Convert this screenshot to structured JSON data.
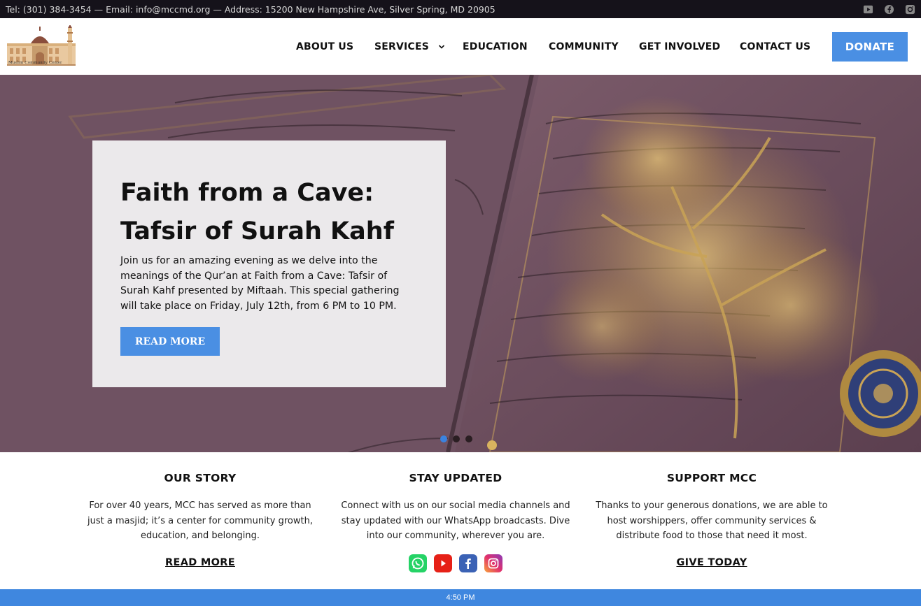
{
  "topbar": {
    "contact": "Tel: (301) 384-3454 — Email: info@mccmd.org — Address: 15200 New Hampshire Ave, Silver Spring, MD 20905",
    "socials": [
      "youtube-icon",
      "facebook-icon",
      "instagram-icon"
    ]
  },
  "header": {
    "logo_text": "Muslim Community Center",
    "nav": {
      "about": "ABOUT US",
      "services": "SERVICES",
      "education": "EDUCATION",
      "community": "COMMUNITY",
      "involved": "GET INVOLVED",
      "contact": "CONTACT US"
    },
    "donate": "DONATE"
  },
  "hero": {
    "title": "Faith from a Cave: Tafsir of Surah Kahf",
    "description": "Join us for an amazing evening as we delve into the meanings of the Qur’an at Faith from a Cave: Tafsir of Surah Kahf presented by Miftaah. This special gathering will take place on Friday, July 12th, from 6 PM to 10 PM.",
    "button": "READ MORE",
    "slides": 3,
    "active_slide": 1
  },
  "info": {
    "story": {
      "title": "OUR STORY",
      "text": "For over 40 years, MCC has served as more than just a masjid; it’s a center for community growth, education, and belonging.",
      "link": "READ MORE"
    },
    "updated": {
      "title": "STAY UPDATED",
      "text": "Connect with us on our social media channels and stay updated with our WhatsApp broadcasts. Dive into our community, wherever you are.",
      "icons": [
        "whatsapp-icon",
        "youtube-icon",
        "facebook-icon",
        "instagram-icon"
      ]
    },
    "support": {
      "title": "SUPPORT MCC",
      "text": "Thanks to your generous donations, we are able to host worshippers, offer community services & distribute food to those that need it most.",
      "link": "GIVE TODAY"
    }
  },
  "bottombar": {
    "time": "4:50 PM"
  },
  "colors": {
    "accent": "#4a8fe3",
    "topbar": "#15121a",
    "bottombar": "#3f87df"
  }
}
